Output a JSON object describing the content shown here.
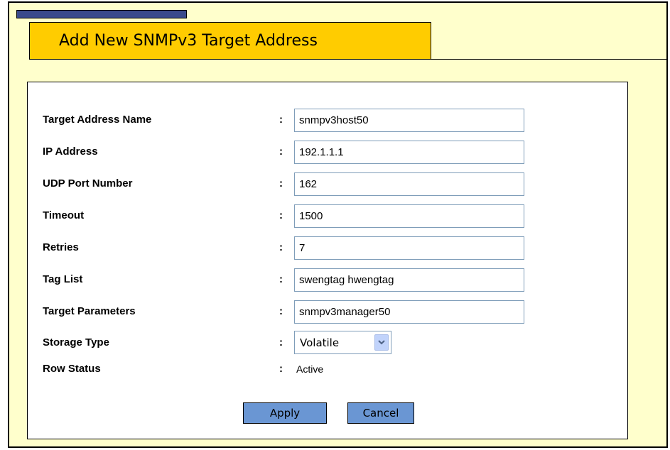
{
  "header": {
    "title": "Add New SNMPv3 Target Address"
  },
  "form": {
    "separator": ":",
    "fields": [
      {
        "label": "Target Address Name",
        "value": "snmpv3host50"
      },
      {
        "label": "IP Address",
        "value": "192.1.1.1"
      },
      {
        "label": "UDP Port Number",
        "value": "162"
      },
      {
        "label": "Timeout",
        "value": "1500"
      },
      {
        "label": "Retries",
        "value": "7"
      },
      {
        "label": "Tag List",
        "value": "swengtag hwengtag"
      },
      {
        "label": "Target Parameters",
        "value": "snmpv3manager50"
      }
    ],
    "storage_type": {
      "label": "Storage Type",
      "selected": "Volatile",
      "icon": "chevron-down-icon"
    },
    "row_status": {
      "label": "Row Status",
      "value": "Active"
    }
  },
  "buttons": {
    "apply_label": "Apply",
    "cancel_label": "Cancel"
  },
  "colors": {
    "page_background": "#ffffcc",
    "title_tab": "#ffcc00",
    "title_accent": "#3a4a8c",
    "button_background": "#6a96d3",
    "input_border": "#7f9db9",
    "dropdown_arrow_background": "#c1d3fb",
    "dropdown_chevron": "#4d6185"
  }
}
